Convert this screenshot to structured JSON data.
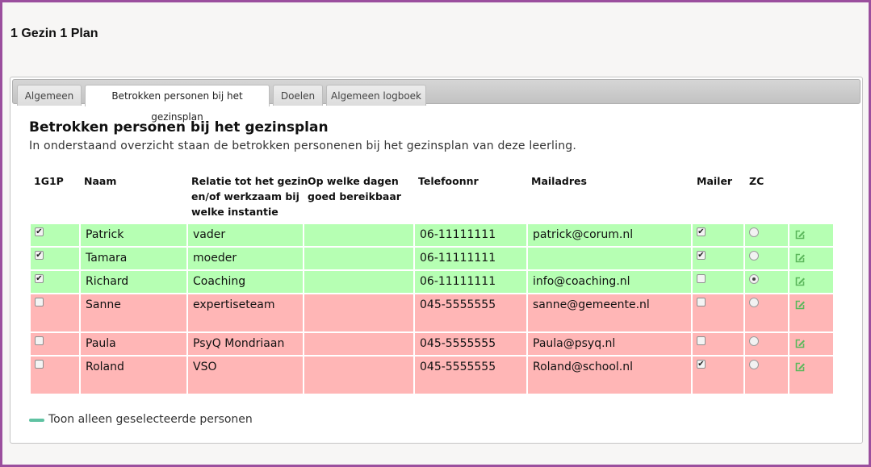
{
  "app": {
    "title": "1 Gezin 1 Plan"
  },
  "tabs": [
    {
      "label": "Algemeen",
      "active": false
    },
    {
      "label": "Betrokken personen bij het gezinsplan",
      "active": true
    },
    {
      "label": "Doelen",
      "active": false
    },
    {
      "label": "Algemeen logboek",
      "active": false
    }
  ],
  "section": {
    "title": "Betrokken personen bij het gezinsplan",
    "subtitle": "In onderstaand overzicht staan de betrokken personenen bij het gezinsplan van deze leerling."
  },
  "table": {
    "headers": {
      "g1p": "1G1P",
      "naam": "Naam",
      "relatie_l1": "Relatie tot het gezin",
      "relatie_l2": "en/of werkzaam bij",
      "relatie_l3": "welke instantie",
      "dagen_l1": "Op welke dagen",
      "dagen_l2": "goed bereikbaar",
      "telefoon": "Telefoonnr",
      "mail": "Mailadres",
      "mailer": "Mailer",
      "zc": "ZC"
    },
    "rows": [
      {
        "g1p": true,
        "naam": "Patrick",
        "relatie": "vader",
        "dagen": "",
        "telefoon": "06-11111111",
        "mail": "patrick@corum.nl",
        "mailer": true,
        "zc": false,
        "status": "green"
      },
      {
        "g1p": true,
        "naam": "Tamara",
        "relatie": "moeder",
        "dagen": "",
        "telefoon": "06-11111111",
        "mail": "",
        "mailer": true,
        "zc": false,
        "status": "green"
      },
      {
        "g1p": true,
        "naam": "Richard",
        "relatie": "Coaching",
        "dagen": "",
        "telefoon": "06-11111111",
        "mail": "info@coaching.nl",
        "mailer": false,
        "zc": true,
        "status": "green"
      },
      {
        "g1p": false,
        "naam": "Sanne",
        "relatie": "expertiseteam",
        "dagen": "",
        "telefoon": "045-5555555",
        "mail": "sanne@gemeente.nl",
        "mailer": false,
        "zc": false,
        "status": "red"
      },
      {
        "g1p": false,
        "naam": "Paula",
        "relatie": "PsyQ Mondriaan",
        "dagen": "",
        "telefoon": "045-5555555",
        "mail": "Paula@psyq.nl",
        "mailer": false,
        "zc": false,
        "status": "red"
      },
      {
        "g1p": false,
        "naam": "Roland",
        "relatie": "VSO",
        "dagen": "",
        "telefoon": "045-5555555",
        "mail": "Roland@school.nl",
        "mailer": true,
        "zc": false,
        "status": "red"
      }
    ]
  },
  "legend": {
    "label": "Toon alleen geselecteerde personen",
    "color": "#5fc2a2"
  },
  "colors": {
    "row_green": "#b6ffb3",
    "row_red": "#ffb6b6",
    "frame": "#9b4f9e",
    "edit_icon": "#5cb85c"
  },
  "icons": {
    "edit": "edit-icon"
  }
}
